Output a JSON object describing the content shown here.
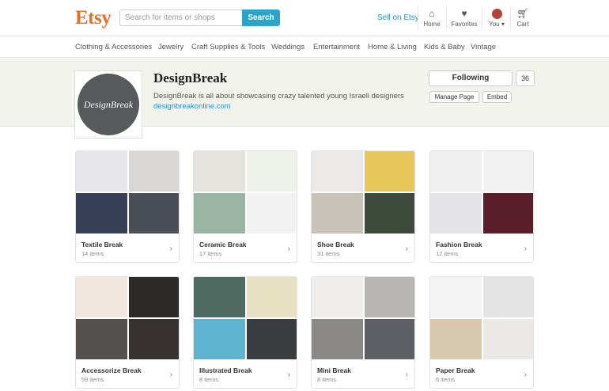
{
  "header": {
    "logo": "Etsy",
    "search_placeholder": "Search for items or shops",
    "search_button": "Search",
    "sell_link": "Sell on Etsy",
    "icons": [
      {
        "label": "Home",
        "icon": "home-icon"
      },
      {
        "label": "Favorites",
        "icon": "heart-icon"
      },
      {
        "label": "You ▾",
        "icon": "avatar-icon"
      },
      {
        "label": "Cart",
        "icon": "cart-icon"
      }
    ]
  },
  "nav": {
    "items": [
      "Clothing & Accessories",
      "Jewelry",
      "Craft Supplies & Tools",
      "Weddings",
      "Entertainment",
      "Home & Living",
      "Kids & Baby",
      "Vintage"
    ]
  },
  "shop": {
    "avatar_text": "DesignBreak",
    "name": "DesignBreak",
    "tagline": "DesignBreak is all about showcasing crazy talented young Israeli designers",
    "link": "designbreakonline.com",
    "following_label": "Following",
    "follower_count": "36",
    "manage_label": "Manage Page",
    "embed_label": "Embed"
  },
  "collections": [
    {
      "title": "Textile Break",
      "items": "14 items",
      "colors": [
        "#e7e7ea",
        "#d9d7d3",
        "#3a3f58",
        "#4a4e56"
      ]
    },
    {
      "title": "Ceramic Break",
      "items": "17 items",
      "colors": [
        "#e5e3dd",
        "#eef0ea",
        "#9ab5a3",
        "#f2f2f2"
      ]
    },
    {
      "title": "Shoe Break",
      "items": "31 items",
      "colors": [
        "#eceae8",
        "#e8c75a",
        "#c8c2b8",
        "#3e4a3c"
      ]
    },
    {
      "title": "Fashion Break",
      "items": "12 items",
      "colors": [
        "#efefef",
        "#f2f2f2",
        "#e3e3e6",
        "#5a1e2a"
      ]
    },
    {
      "title": "Accessorize Break",
      "items": "59 items",
      "colors": [
        "#efe7e0",
        "#2d2a28",
        "#54504e",
        "#37312f"
      ]
    },
    {
      "title": "Illustrated Break",
      "items": "8 items",
      "colors": [
        "#4e6b62",
        "#e7e1c4",
        "#5eb3d0",
        "#3a3d40"
      ]
    },
    {
      "title": "Mini Break",
      "items": "8 items",
      "colors": [
        "#efeeec",
        "#b7b6b2",
        "#8a8985",
        "#5c5f63"
      ]
    },
    {
      "title": "Paper Break",
      "items": "6 items",
      "colors": [
        "#f3f3f3",
        "#e4e4e4",
        "#d9c8b0",
        "#ebe9e6"
      ]
    }
  ],
  "chevron": "›"
}
